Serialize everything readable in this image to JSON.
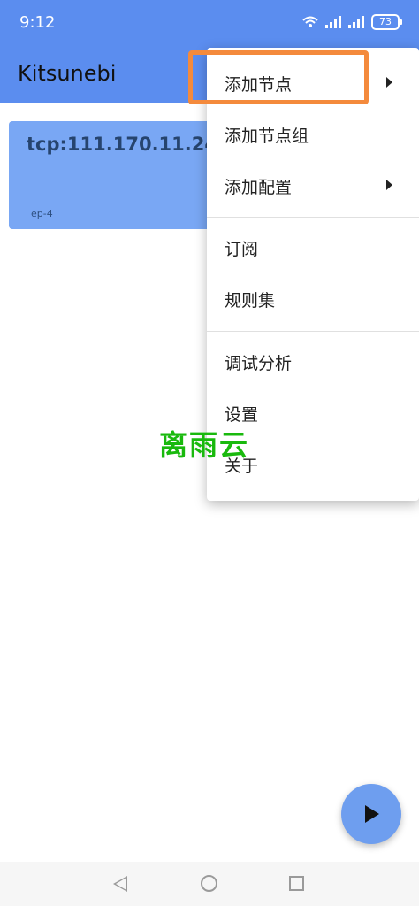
{
  "status": {
    "time": "9:12",
    "battery": "73"
  },
  "appbar": {
    "title": "Kitsunebi"
  },
  "card": {
    "title": "tcp:111.170.11.244",
    "subtitle": "ep-4"
  },
  "menu": {
    "items": [
      {
        "label": "添加节点",
        "submenu": true
      },
      {
        "label": "添加节点组",
        "submenu": false
      },
      {
        "label": "添加配置",
        "submenu": true
      },
      {
        "label": "订阅",
        "submenu": false
      },
      {
        "label": "规则集",
        "submenu": false
      },
      {
        "label": "调试分析",
        "submenu": false
      },
      {
        "label": "设置",
        "submenu": false
      },
      {
        "label": "关于",
        "submenu": false
      }
    ]
  },
  "watermark": "离雨云",
  "colors": {
    "primary": "#5b8def",
    "card": "#79a7f4",
    "highlight": "#f48a3c",
    "watermark": "#19b90d"
  },
  "icons": {
    "fab": "play-icon",
    "nav_back": "back-icon",
    "nav_home": "home-icon",
    "nav_recent": "recent-apps-icon"
  }
}
